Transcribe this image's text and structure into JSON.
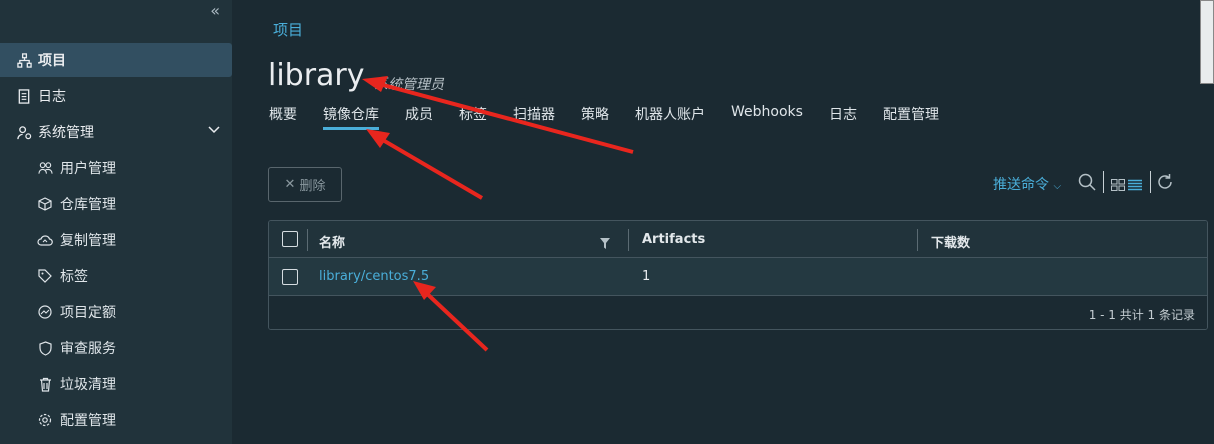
{
  "sidebar": {
    "collapse_icon": "double-chevron-left-icon",
    "items": [
      {
        "label": "项目",
        "icon": "project-icon",
        "active": true
      },
      {
        "label": "日志",
        "icon": "log-icon"
      },
      {
        "label": "系统管理",
        "icon": "admin-icon"
      }
    ],
    "sub_items": [
      {
        "label": "用户管理",
        "icon": "users-icon"
      },
      {
        "label": "仓库管理",
        "icon": "registry-icon"
      },
      {
        "label": "复制管理",
        "icon": "replication-icon"
      },
      {
        "label": "标签",
        "icon": "tag-icon"
      },
      {
        "label": "项目定额",
        "icon": "quota-icon"
      },
      {
        "label": "审查服务",
        "icon": "shield-icon"
      },
      {
        "label": "垃圾清理",
        "icon": "trash-icon"
      },
      {
        "label": "配置管理",
        "icon": "gear-icon"
      }
    ]
  },
  "breadcrumb": "项目",
  "project": {
    "name": "library",
    "role": "系统管理员"
  },
  "tabs": [
    "概要",
    "镜像仓库",
    "成员",
    "标签",
    "扫描器",
    "策略",
    "机器人账户",
    "Webhooks",
    "日志",
    "配置管理"
  ],
  "toolbar": {
    "delete_label": "删除",
    "push_label": "推送命令"
  },
  "table": {
    "columns": [
      "名称",
      "Artifacts",
      "下载数"
    ],
    "rows": [
      {
        "name": "library/centos7.5",
        "artifacts": "1",
        "pulls": ""
      }
    ],
    "footer": "1 - 1 共计 1 条记录"
  },
  "colors": {
    "accent": "#4aaed9",
    "annotation": "#e8261e",
    "sidebar_active": "#324f61"
  }
}
